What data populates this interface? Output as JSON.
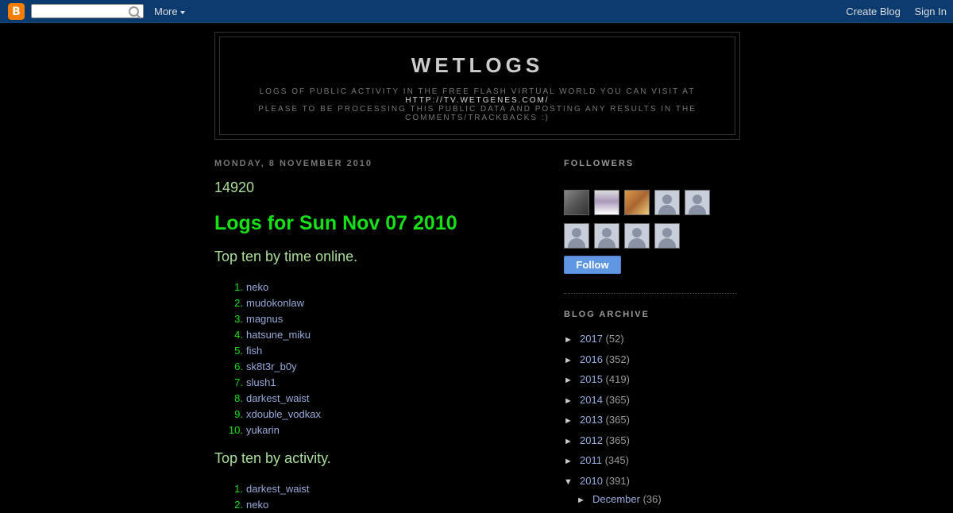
{
  "navbar": {
    "search_placeholder": "",
    "more_label": "More",
    "create_blog_label": "Create Blog",
    "sign_in_label": "Sign In",
    "logo_glyph": "B"
  },
  "header": {
    "title": "WETLOGS",
    "desc_line1": "Logs of public activity in the free flash virtual world you can visit at",
    "desc_url": "http://tv.wetgenes.com/",
    "desc_line2": "Please to be processing this public data and posting any results in the comments/trackbacks :)"
  },
  "post": {
    "date": "MONDAY, 8 NOVEMBER 2010",
    "title": "14920",
    "heading": "Logs for Sun Nov 07 2010",
    "section1_title": "Top ten by time online.",
    "section1_items": [
      {
        "num": "1.",
        "name": "neko"
      },
      {
        "num": "2.",
        "name": "mudokonlaw"
      },
      {
        "num": "3.",
        "name": "magnus"
      },
      {
        "num": "4.",
        "name": "hatsune_miku"
      },
      {
        "num": "5.",
        "name": "fish"
      },
      {
        "num": "6.",
        "name": "sk8t3r_b0y"
      },
      {
        "num": "7.",
        "name": "slush1"
      },
      {
        "num": "8.",
        "name": "darkest_waist"
      },
      {
        "num": "9.",
        "name": "xdouble_vodkax"
      },
      {
        "num": "10.",
        "name": "yukarin"
      }
    ],
    "section2_title": "Top ten by activity.",
    "section2_items": [
      {
        "num": "1.",
        "name": "darkest_waist"
      },
      {
        "num": "2.",
        "name": "neko"
      }
    ]
  },
  "sidebar": {
    "followers_title": "FOLLOWERS",
    "follow_label": "Follow",
    "archive_title": "BLOG ARCHIVE",
    "archive": [
      {
        "toggle": "►",
        "year": "2017",
        "count": "(52)"
      },
      {
        "toggle": "►",
        "year": "2016",
        "count": "(352)"
      },
      {
        "toggle": "►",
        "year": "2015",
        "count": "(419)"
      },
      {
        "toggle": "►",
        "year": "2014",
        "count": "(365)"
      },
      {
        "toggle": "►",
        "year": "2013",
        "count": "(365)"
      },
      {
        "toggle": "►",
        "year": "2012",
        "count": "(365)"
      },
      {
        "toggle": "►",
        "year": "2011",
        "count": "(345)"
      },
      {
        "toggle": "▼",
        "year": "2010",
        "count": "(391)"
      }
    ],
    "archive_child": {
      "toggle": "►",
      "month": "December",
      "count": "(36)"
    }
  },
  "colors": {
    "background": "#000000",
    "navbar": "#0a3a6e",
    "heading_green": "#16e016",
    "title_green": "#aadd99",
    "link_blue": "#99aadd",
    "follow_button": "#5f97e3"
  }
}
